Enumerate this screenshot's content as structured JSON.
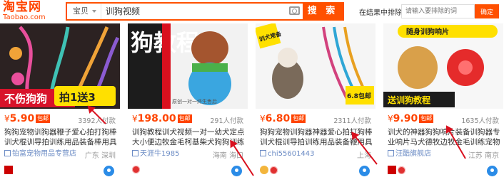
{
  "logo": {
    "cn": "淘宝网",
    "en": "Taobao.com"
  },
  "search": {
    "type": "宝贝",
    "query": "训狗视频",
    "button": "搜 索"
  },
  "exclude": {
    "label": "在结果中排除",
    "placeholder": "请输入要排除的词",
    "button": "确定"
  },
  "products": [
    {
      "image_text_main": "不伤狗狗",
      "image_text_sub": "拍1送3",
      "price_symbol": "¥",
      "price": "5.90",
      "postage": "包邮",
      "paid": "3392人付款",
      "title": "狗狗宠物训狗器鞭子爱心拍打狗棒训犬棍训导拍训练用品装备棒用具",
      "shop": "铂富宠物用品专营店",
      "location": "广东 深圳"
    },
    {
      "image_text_main": "狗教程",
      "image_text_sub": "原创一对一终生售后",
      "price_symbol": "¥",
      "price": "198.00",
      "postage": "包邮",
      "paid": "291人付款",
      "title": "训狗教程训犬视频一对一幼犬定点大小便边牧金毛柯基柴犬狗狗训练",
      "shop": "天涯牛1985",
      "location": "海南 海口"
    },
    {
      "image_text_main": "训犬常备",
      "image_text_sub": "6.8包邮",
      "price_symbol": "¥",
      "price": "6.80",
      "postage": "包邮",
      "paid": "2311人付款",
      "title": "狗狗宠物训狗器神器爱心拍打狗棒训犬棍训导拍训练用品装备鞭用具",
      "shop": "chi55601443",
      "location": "上海"
    },
    {
      "image_text_main": "随身训狗响片",
      "image_text_sub": "送训狗教程",
      "price_symbol": "¥",
      "price": "9.90",
      "postage": "包邮",
      "paid": "1635人付款",
      "title": "训犬的神器狗狗响片装备训狗器专业响片马犬德牧边牧金毛训练宠物用品",
      "shop": "汪酷旗舰店",
      "location": "江苏 南京"
    }
  ]
}
